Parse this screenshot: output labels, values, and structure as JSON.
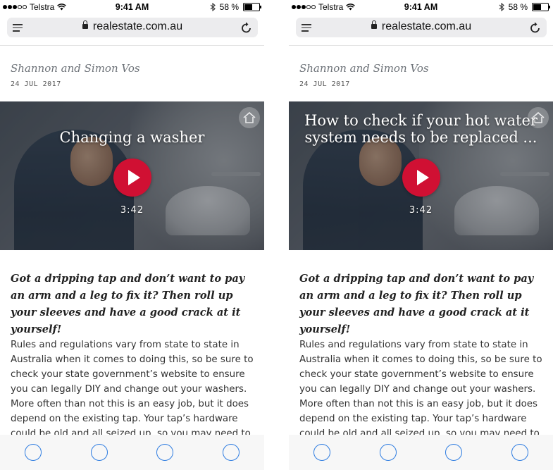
{
  "status": {
    "carrier": "Telstra",
    "time": "9:41 AM",
    "battery": "58 %",
    "battery_level": 0.58
  },
  "browser": {
    "url": "realestate.com.au"
  },
  "article": {
    "author": "Shannon and Simon Vos",
    "date": "24 JUL 2017",
    "lede": "Got a dripping tap and don’t want to pay an arm and a leg to fix it? Then roll up your sleeves and have a good crack at it yourself!",
    "body": "Rules and regulations vary from state to state in Australia when it comes to doing this, so be sure to check your state government’s website to ensure you can legally DIY and change out your washers. More often than not this is an easy job, but it does depend on the existing tap. Your tap’s hardware could be old and all seized up, so you may need to call a plumber."
  },
  "screens": [
    {
      "video_title": "Changing a washer",
      "video_duration": "3:42"
    },
    {
      "video_title": "How to check if your hot water system needs to be replaced ...",
      "video_duration": "3:42"
    }
  ],
  "colors": {
    "accent": "#2f7de1",
    "play_button": "#d01033",
    "author_text": "#6d7278"
  }
}
